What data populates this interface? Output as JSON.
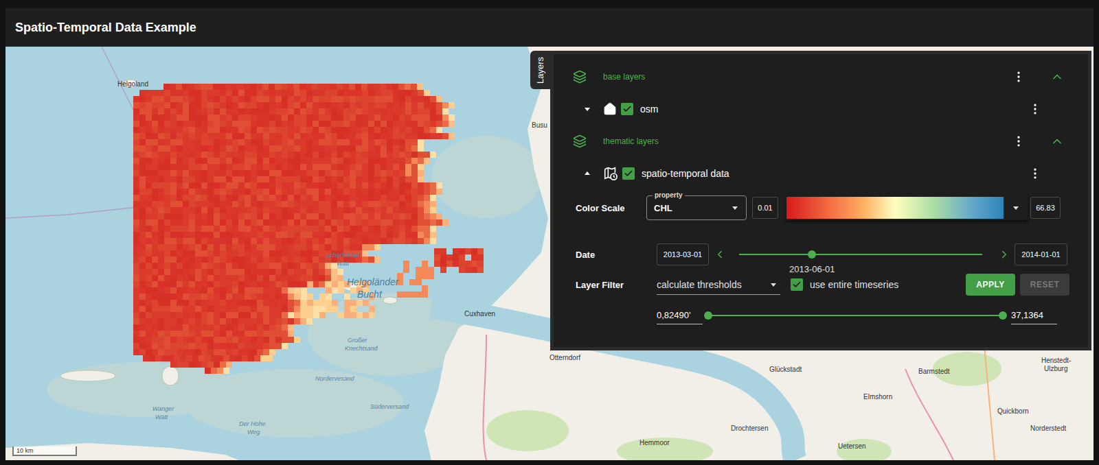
{
  "window": {
    "title": "Spatio-Temporal Data Example"
  },
  "map": {
    "labels": [
      {
        "text": "Helgoland",
        "kind": "town"
      },
      {
        "text": "Busu",
        "kind": "town"
      },
      {
        "text": "Scharhörner",
        "kind": "water"
      },
      {
        "text": "Watt",
        "kind": "water"
      },
      {
        "text": "Helgoländer",
        "kind": "sea"
      },
      {
        "text": "Bucht",
        "kind": "sea"
      },
      {
        "text": "Cuxhaven",
        "kind": "town"
      },
      {
        "text": "Otterndorf",
        "kind": "town"
      },
      {
        "text": "Großer",
        "kind": "water"
      },
      {
        "text": "Knechtsand",
        "kind": "water"
      },
      {
        "text": "Nordervesand",
        "kind": "water"
      },
      {
        "text": "Süderversand",
        "kind": "water"
      },
      {
        "text": "Wanger",
        "kind": "water"
      },
      {
        "text": "Watt",
        "kind": "water"
      },
      {
        "text": "Der Hohe",
        "kind": "water"
      },
      {
        "text": "Weg",
        "kind": "water"
      },
      {
        "text": "Glückstadt",
        "kind": "town"
      },
      {
        "text": "Barmstedt",
        "kind": "town"
      },
      {
        "text": "Henstedt-",
        "kind": "town"
      },
      {
        "text": "Ulzburg",
        "kind": "town"
      },
      {
        "text": "Elmshorn",
        "kind": "town"
      },
      {
        "text": "Quickborn",
        "kind": "town"
      },
      {
        "text": "Drochtersen",
        "kind": "town"
      },
      {
        "text": "Norderstedt",
        "kind": "town"
      },
      {
        "text": "Hemmoor",
        "kind": "town"
      },
      {
        "text": "Uetersen",
        "kind": "town"
      }
    ],
    "scale": "10 km"
  },
  "layers_tab": {
    "label": "Layers"
  },
  "layer_groups": [
    {
      "title": "base layers",
      "expanded": true,
      "layers": [
        {
          "name": "osm",
          "visible": true,
          "expanded": false,
          "kind": "base"
        }
      ]
    },
    {
      "title": "thematic layers",
      "expanded": true,
      "layers": [
        {
          "name": "spatio-temporal data",
          "visible": true,
          "expanded": true,
          "kind": "temporal"
        }
      ]
    }
  ],
  "color_scale": {
    "label": "Color Scale",
    "property_label": "property",
    "property": "CHL",
    "min": "0.01",
    "max": "66.83"
  },
  "date": {
    "label": "Date",
    "start": "2013-03-01",
    "current": "2013-06-01",
    "end": "2014-01-01",
    "level": 0.3
  },
  "layer_filter": {
    "label": "Layer Filter",
    "mode": "calculate thresholds",
    "entire_timeseries": {
      "label": "use entire timeseries",
      "checked": true
    },
    "buttons": [
      {
        "label": "APPLY",
        "disabled": false
      },
      {
        "label": "RESET",
        "disabled": true
      }
    ],
    "range": {
      "min": "0,82490'",
      "max": "37,1364",
      "low": 0,
      "high": 1
    }
  }
}
